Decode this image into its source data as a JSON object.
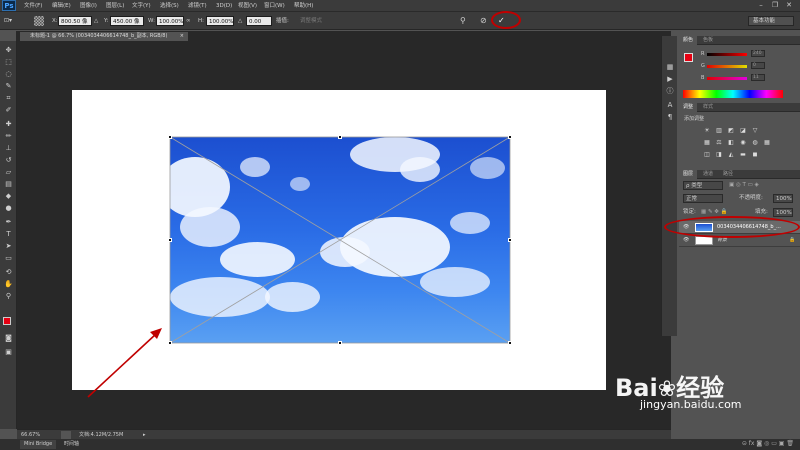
{
  "app": {
    "logo": "Ps"
  },
  "menu": [
    "文件(F)",
    "编辑(E)",
    "图像(I)",
    "图层(L)",
    "文字(Y)",
    "选择(S)",
    "滤镜(T)",
    "3D(D)",
    "视图(V)",
    "窗口(W)",
    "帮助(H)"
  ],
  "options": {
    "x_label": "X:",
    "x_value": "800.50 像",
    "y_label": "Y:",
    "y_value": "450.00 像",
    "w_label": "W:",
    "w_value": "100.00%",
    "h_label": "H:",
    "h_value": "100.00%",
    "angle_label": "△",
    "angle_value": "0.00",
    "interp_label": "插值:",
    "warp_label": "调整模式",
    "workspace": "基本功能"
  },
  "document": {
    "tab_label": "未标题-1 @ 66.7% (0034034406614748_b_副本, RGB/8)",
    "close": "×"
  },
  "status": {
    "zoom": "66.67%",
    "doc_info": "文档:4.12M/2.75M"
  },
  "bottom_tabs": [
    "Mini Bridge",
    "时间轴"
  ],
  "color_panel": {
    "tabs": [
      "颜色",
      "色板"
    ],
    "channels": [
      {
        "label": "R",
        "value": "240"
      },
      {
        "label": "G",
        "value": "0"
      },
      {
        "label": "B",
        "value": "11"
      }
    ],
    "foreground": "#e60012",
    "background": "#000000"
  },
  "adjust_panel": {
    "tabs": [
      "调整",
      "样式"
    ],
    "title": "添加调整"
  },
  "layers_panel": {
    "tabs": [
      "图层",
      "通道",
      "路径"
    ],
    "kind_label": "ρ 类型",
    "blend_mode": "正常",
    "opacity_label": "不透明度:",
    "opacity_value": "100%",
    "lock_label": "锁定:",
    "fill_label": "填充:",
    "fill_value": "100%",
    "layers": [
      {
        "name": "0034034406614748_b_...",
        "selected": true
      },
      {
        "name": "背景",
        "selected": false
      }
    ]
  },
  "watermark": {
    "brand": "Bai",
    "brand2": "经验",
    "url": "jingyan.baidu.com"
  },
  "colors": {
    "accent": "#c00000",
    "sky_top": "#1c4fd0",
    "sky_bottom": "#5aa0f2"
  }
}
